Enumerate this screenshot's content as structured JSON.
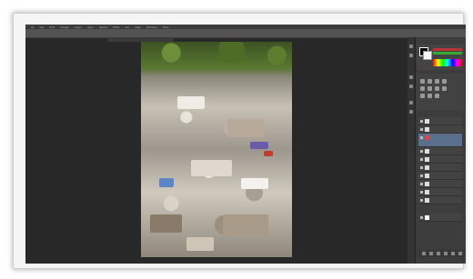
{
  "window": {
    "accent": "#282828",
    "panel": "#3c3c3c"
  },
  "menubar": {
    "items": [
      "Ps",
      "File",
      "Edit",
      "Image",
      "Layer",
      "Type",
      "Select",
      "Filter",
      "3D",
      "View",
      "Window",
      "Help"
    ]
  },
  "options": {
    "items": [
      "",
      "",
      "",
      "",
      ""
    ]
  },
  "document": {
    "tab_label": ""
  },
  "layers": {
    "rows": [
      {
        "name": "",
        "selected": false
      },
      {
        "name": "",
        "selected": false
      },
      {
        "name": "",
        "selected": true
      },
      {
        "name": "",
        "selected": false
      },
      {
        "name": "",
        "selected": false
      },
      {
        "name": "",
        "selected": false
      },
      {
        "name": "",
        "selected": false
      },
      {
        "name": "",
        "selected": false
      },
      {
        "name": "",
        "selected": false
      },
      {
        "name": "",
        "selected": false
      },
      {
        "name": "",
        "selected": false
      }
    ]
  }
}
